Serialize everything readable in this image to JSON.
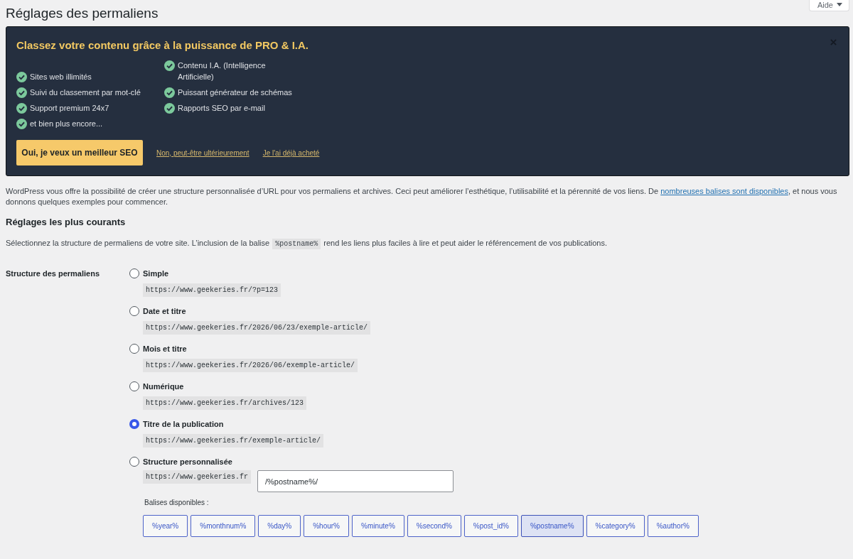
{
  "page": {
    "title": "Réglages des permaliens",
    "help_button": {
      "label": "Aide",
      "expanded": false
    }
  },
  "banner": {
    "title": "Classez votre contenu grâce à la puissance de PRO & I.A.",
    "features": [
      [
        "Sites web illimités",
        "Suivi du classement par mot-clé",
        "Support premium 24x7",
        "et bien plus encore..."
      ],
      [
        "Contenu I.A. (Intelligence Artificielle)",
        "Puissant générateur de schémas",
        "Rapports SEO par e-mail"
      ]
    ],
    "primary_button": "Oui, je veux un meilleur SEO",
    "links": [
      "Non, peut-être ultérieurement",
      "Je l'ai déjà acheté"
    ]
  },
  "intro": {
    "before": "WordPress vous offre la possibilité de créer une structure personnalisée d’URL pour vos permaliens et archives. Ceci peut améliorer l’esthétique, l’utilisabilité et la pérennité de vos liens. De",
    "link": "nombreuses balises sont disponibles",
    "after": ", et nous vous donnons quelques exemples pour commencer."
  },
  "common_settings": {
    "heading": "Réglages les plus courants",
    "description": {
      "before": "Sélectionnez la structure de permaliens de votre site. L’inclusion de la balise",
      "code": "%postname%",
      "after": "rend les liens plus faciles à lire et peut aider le référencement de vos publications."
    }
  },
  "permalinks": {
    "label": "Structure des permaliens",
    "options": [
      {
        "kind": "preset",
        "label": "Simple",
        "example": "https://www.geekeries.fr/?p=123",
        "selected": false
      },
      {
        "kind": "preset",
        "label": "Date et titre",
        "example": "https://www.geekeries.fr/2026/06/23/exemple-article/",
        "selected": false
      },
      {
        "kind": "preset",
        "label": "Mois et titre",
        "example": "https://www.geekeries.fr/2026/06/exemple-article/",
        "selected": false
      },
      {
        "kind": "preset",
        "label": "Numérique",
        "example": "https://www.geekeries.fr/archives/123",
        "selected": false
      },
      {
        "kind": "preset",
        "label": "Titre de la publication",
        "example": "https://www.geekeries.fr/exemple-article/",
        "selected": true
      },
      {
        "kind": "custom",
        "label": "Structure personnalisée",
        "prefix": "https://www.geekeries.fr",
        "value": "/%postname%/",
        "selected": false
      }
    ],
    "tags_label": "Balises disponibles :",
    "tags": [
      {
        "label": "%year%",
        "selected": false
      },
      {
        "label": "%monthnum%",
        "selected": false
      },
      {
        "label": "%day%",
        "selected": false
      },
      {
        "label": "%hour%",
        "selected": false
      },
      {
        "label": "%minute%",
        "selected": false
      },
      {
        "label": "%second%",
        "selected": false
      },
      {
        "label": "%post_id%",
        "selected": false
      },
      {
        "label": "%postname%",
        "selected": true
      },
      {
        "label": "%category%",
        "selected": false
      },
      {
        "label": "%author%",
        "selected": false
      }
    ]
  }
}
